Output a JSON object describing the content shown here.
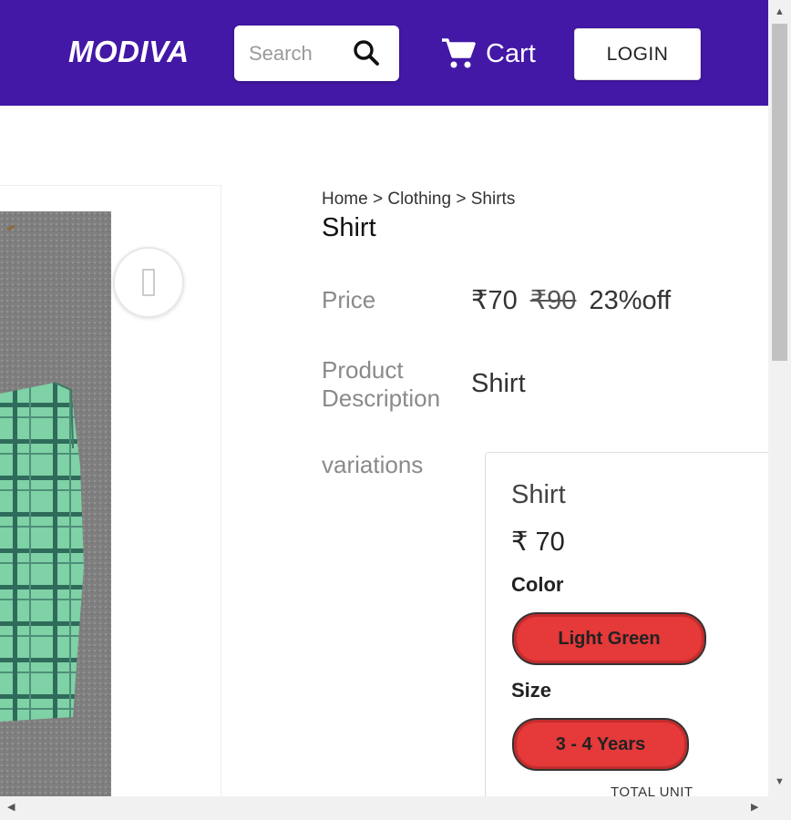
{
  "header": {
    "logo": "MODIVA",
    "search_placeholder": "Search",
    "cart_label": "Cart",
    "login_label": "LOGIN",
    "bg_color": "#4318a6"
  },
  "breadcrumb": {
    "home": "Home",
    "sep1": ">",
    "category": "Clothing",
    "sep2": ">",
    "subcategory": "Shirts"
  },
  "product": {
    "title": "Shirt",
    "price_label": "Price",
    "price": "₹70",
    "mrp": "₹90",
    "discount": "23%off",
    "description_label_line1": "Product",
    "description_label_line2": "Description",
    "description": "Shirt",
    "variations_label": "variations"
  },
  "variation": {
    "name": "Shirt",
    "price": "₹ 70",
    "color_label": "Color",
    "color_value": "Light Green",
    "size_label": "Size",
    "size_value": "3 - 4 Years",
    "total_unit_label": "TOTAL UNIT"
  },
  "icons": {
    "search": "search-icon",
    "cart": "cart-icon",
    "wishlist": "heart-icon"
  }
}
